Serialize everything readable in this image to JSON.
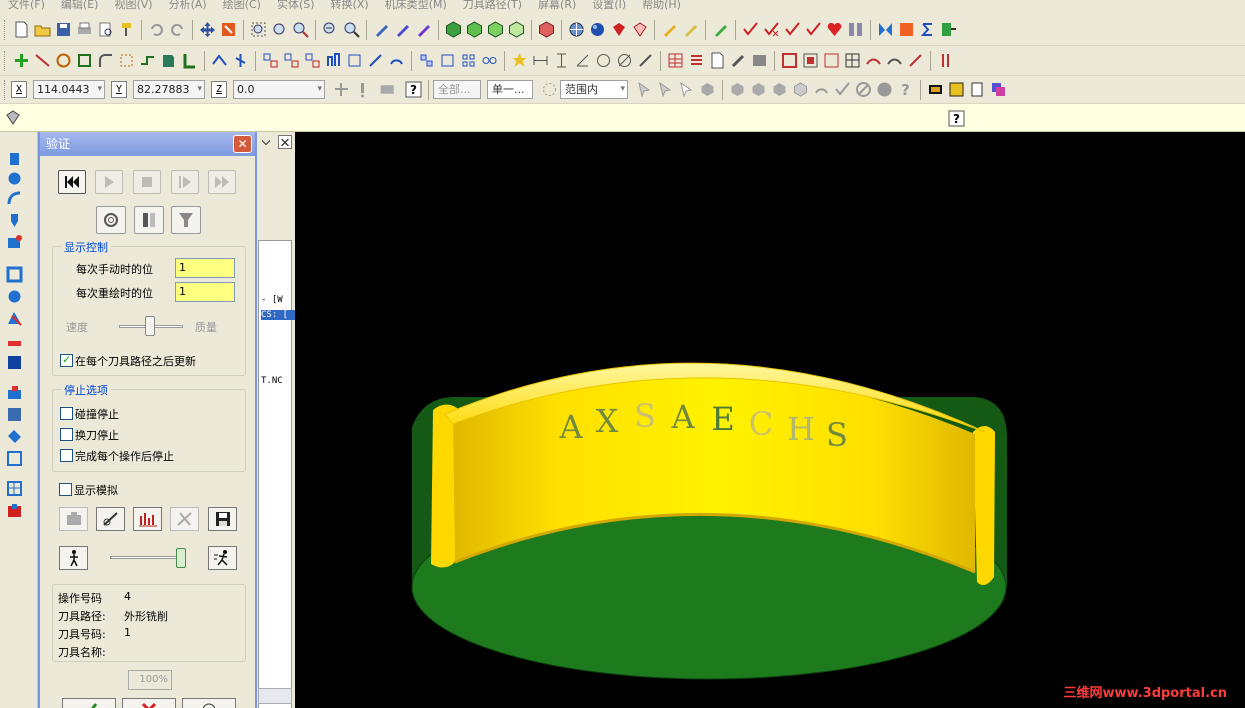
{
  "menu": [
    "文件(F)",
    "编辑(E)",
    "视图(V)",
    "分析(A)",
    "绘图(C)",
    "实体(S)",
    "转换(X)",
    "机床类型(M)",
    "刀具路径(T)",
    "屏幕(R)",
    "设置(I)",
    "帮助(H)"
  ],
  "toolbar3": {
    "x_label": "X",
    "x_value": "114.0443",
    "y_label": "Y",
    "y_value": "82.27883",
    "z_label": "Z",
    "z_value": "0.0",
    "mask_all": "全部...",
    "mask_single": "单一...",
    "range": "范围内"
  },
  "left_panel": {
    "code1": "- [W",
    "code2": "CS: [",
    "code3": "T.NC"
  },
  "verify": {
    "title": "验证",
    "display_group": "显示控制",
    "step_label": "每次手动时的位",
    "step_value": "1",
    "redraw_label": "每次重绘时的位",
    "redraw_value": "1",
    "speed_label": "速度",
    "quality_label": "质量",
    "update_after_each": "在每个刀具路径之后更新",
    "stop_group": "停止选项",
    "stop_on_collision": "碰撞停止",
    "stop_on_tool_change": "换刀停止",
    "stop_after_each_op": "完成每个操作后停止",
    "show_simulation": "显示模拟",
    "info": {
      "op_number_label": "操作号码",
      "op_number": "4",
      "toolpath_label": "刀具路径:",
      "toolpath": "外形铣削",
      "tool_number_label": "刀具号码:",
      "tool_number": "1",
      "tool_name_label": "刀具名称:",
      "tool_name": ""
    },
    "progress": "100%"
  },
  "engraving": [
    "A",
    "X",
    "S",
    "A",
    "E",
    "C",
    "H",
    "S"
  ],
  "watermark": "三维网www.3dportal.cn",
  "colors": {
    "viewport_bg": "#000000",
    "ring": "#ffd800",
    "base": "#1d6b1d",
    "text_engrave": "#6f8a3c"
  }
}
